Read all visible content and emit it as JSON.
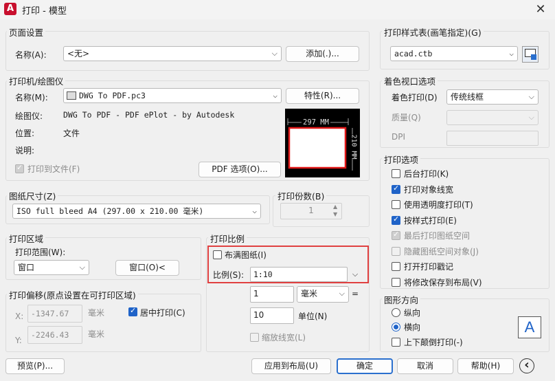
{
  "window": {
    "title": "打印 - 模型",
    "app_icon": "A",
    "close": "✕"
  },
  "page_setup": {
    "legend": "页面设置",
    "name_label": "名称(A):",
    "name_value": "<无>",
    "add_button": "添加(.)..."
  },
  "plotter": {
    "legend": "打印机/绘图仪",
    "name_label": "名称(M):",
    "name_value": "DWG To PDF.pc3",
    "properties_button": "特性(R)...",
    "plotter_label": "绘图仪:",
    "plotter_value": "DWG To PDF - PDF ePlot - by Autodesk",
    "location_label": "位置:",
    "location_value": "文件",
    "description_label": "说明:",
    "print_to_file_label": "打印到文件(F)",
    "print_to_file_checked": true,
    "pdf_options_button": "PDF 选项(O)...",
    "preview_width": "297 MM",
    "preview_height": "210 MM"
  },
  "paper_size": {
    "legend": "图纸尺寸(Z)",
    "value": "ISO full bleed A4 (297.00 x 210.00 毫米)"
  },
  "copies": {
    "legend": "打印份数(B)",
    "value": "1"
  },
  "plot_area": {
    "legend": "打印区域",
    "range_label": "打印范围(W):",
    "range_value": "窗口",
    "window_button": "窗口(O)<"
  },
  "plot_offset": {
    "legend": "打印偏移(原点设置在可打印区域)",
    "x_label": "X:",
    "x_value": "-1347.67",
    "x_unit": "毫米",
    "y_label": "Y:",
    "y_value": "-2246.43",
    "y_unit": "毫米",
    "center_label": "居中打印(C)",
    "center_checked": true
  },
  "plot_scale": {
    "legend": "打印比例",
    "fit_label": "布满图纸(I)",
    "fit_checked": false,
    "scale_label": "比例(S):",
    "scale_value": "1:10",
    "value1": "1",
    "unit1": "毫米",
    "equals": "=",
    "value2": "10",
    "unit2": "单位(N)",
    "lineweight_label": "缩放线宽(L)"
  },
  "plot_style_table": {
    "legend": "打印样式表(画笔指定)(G)",
    "value": "acad.ctb"
  },
  "shaded_viewport": {
    "legend": "着色视口选项",
    "shade_label": "着色打印(D)",
    "shade_value": "传统线框",
    "quality_label": "质量(Q)",
    "quality_value": "",
    "dpi_label": "DPI"
  },
  "plot_options": {
    "legend": "打印选项",
    "items": [
      {
        "label": "后台打印(K)",
        "checked": false,
        "disabled": false
      },
      {
        "label": "打印对象线宽",
        "checked": true,
        "disabled": false
      },
      {
        "label": "使用透明度打印(T)",
        "checked": false,
        "disabled": false
      },
      {
        "label": "按样式打印(E)",
        "checked": true,
        "disabled": false
      },
      {
        "label": "最后打印图纸空间",
        "checked": true,
        "disabled": true
      },
      {
        "label": "隐藏图纸空间对象(J)",
        "checked": false,
        "disabled": true
      },
      {
        "label": "打开打印戳记",
        "checked": false,
        "disabled": false
      },
      {
        "label": "将修改保存到布局(V)",
        "checked": false,
        "disabled": false
      }
    ]
  },
  "orientation": {
    "legend": "图形方向",
    "portrait_label": "纵向",
    "landscape_label": "横向",
    "upside_down_label": "上下颠倒打印(-)",
    "selected": "横向",
    "icon_letter": "A"
  },
  "footer": {
    "preview_button": "预览(P)...",
    "apply_button": "应用到布局(U)",
    "ok_button": "确定",
    "cancel_button": "取消",
    "help_button": "帮助(H)",
    "collapse_icon": "‹"
  },
  "colors": {
    "accent": "#1f63c8",
    "highlight": "#e04040",
    "app": "#c8102e"
  }
}
